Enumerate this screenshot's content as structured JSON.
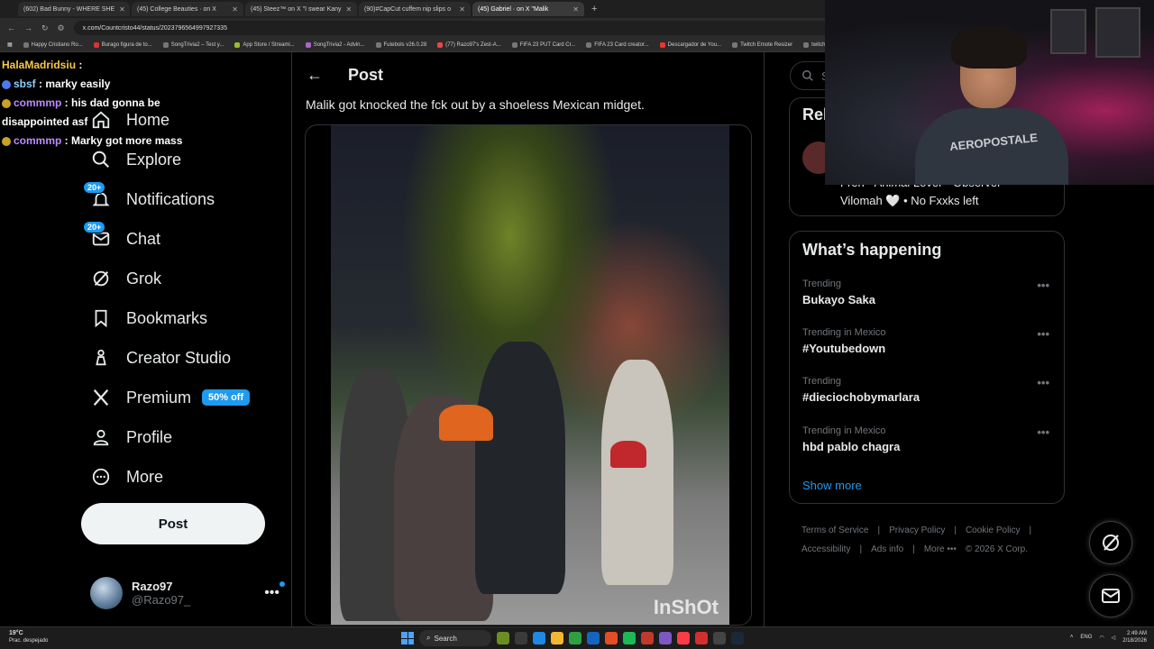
{
  "browser": {
    "tabs": [
      {
        "label": "(602) Bad Bunny - WHERE SHE"
      },
      {
        "label": "(45) College Beauties · on X"
      },
      {
        "label": "(45) Steez™ on X \"I swear Kany"
      },
      {
        "label": "(90)#CapCut cuffem nip slips o"
      },
      {
        "label": "(45) Gabriel · on X \"Malik"
      }
    ],
    "url": "x.com/Countcristo44/status/2023796564997927335",
    "bookmarks": [
      "Happy Cristiano Ro...",
      "Burago figura de to...",
      "SongTrivia2 – Test y...",
      "App Store / Streami...",
      "SongTrivia2 - Advin...",
      "Futebols v26.0.28",
      "(77) Razo97's Zest-A...",
      "FIFA 23 PUT Card Cr...",
      "FIFA 23 Card creator...",
      "Descargador de You...",
      "Twitch Emote Resizer",
      "twitch emote r"
    ]
  },
  "chat": [
    {
      "user": "HalaMadridsiu",
      "text": ""
    },
    {
      "user": "sbsf",
      "text": "marky easily"
    },
    {
      "user": "commmp",
      "text": "his dad gonna be"
    },
    {
      "user": "",
      "text": "disappointed asf"
    },
    {
      "user": "commmp",
      "text": "Marky got more mass"
    }
  ],
  "nav": {
    "home": "Home",
    "explore": "Explore",
    "notifications": "Notifications",
    "notifications_badge": "20+",
    "chat": "Chat",
    "chat_badge": "20+",
    "grok": "Grok",
    "bookmarks": "Bookmarks",
    "creator_studio": "Creator Studio",
    "premium": "Premium",
    "premium_pill": "50% off",
    "profile": "Profile",
    "more": "More",
    "post_button": "Post"
  },
  "account": {
    "name": "Razo97",
    "handle": "@Razo97_",
    "more": "•••"
  },
  "main": {
    "header_title": "Post",
    "post_text": "Malik got knocked the fck out by a shoeless Mexican midget.",
    "video_watermark": "InShOt"
  },
  "right": {
    "search_placeholder": "Se",
    "relevant_title": "Rel",
    "relevant_bio_line1": "Fren - Animal Lover - Observer -",
    "relevant_bio_line2": "Vilomah 🤍 • No Fxxks left",
    "happening_title": "What’s happening",
    "trends": [
      {
        "meta": "Trending",
        "name": "Bukayo Saka"
      },
      {
        "meta": "Trending in Mexico",
        "name": "#Youtubedown"
      },
      {
        "meta": "Trending",
        "name": "#dieciochobymarlara"
      },
      {
        "meta": "Trending in Mexico",
        "name": "hbd pablo chagra"
      }
    ],
    "trend_more": "•••",
    "show_more": "Show more",
    "footer": [
      "Terms of Service",
      "|",
      "Privacy Policy",
      "|",
      "Cookie Policy",
      "|",
      "Accessibility",
      "|",
      "Ads info",
      "|",
      "More •••",
      "© 2026 X Corp."
    ]
  },
  "webcam": {
    "shirt_text": "AEROPOSTALE"
  },
  "taskbar": {
    "weather_temp": "19°C",
    "weather_desc": "Prac. despejado",
    "search_label": "Search",
    "lang": "ENG",
    "time": "2:49 AM",
    "date": "2/18/2026"
  },
  "colors": {
    "accent": "#1d9bf0",
    "background": "#000000",
    "border": "#2f3336",
    "muted": "#71767b"
  }
}
